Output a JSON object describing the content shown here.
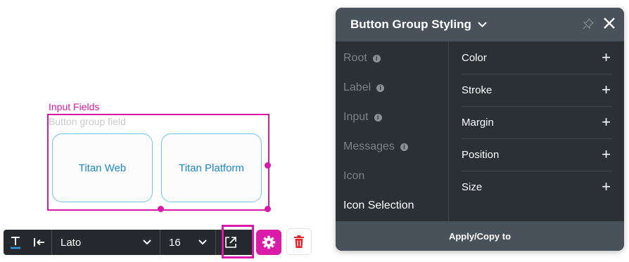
{
  "canvas": {
    "component_title": "Input Fields",
    "component_subtitle": "Button group field",
    "options": [
      {
        "label": "Titan Web"
      },
      {
        "label": "Titan Platform"
      }
    ],
    "accent_color": "#d91ba8"
  },
  "toolbar": {
    "text_icon": "text-format-icon",
    "align_icon": "align-left-icon",
    "font_family": "Lato",
    "font_size": "16",
    "external_link_icon": "external-link-icon",
    "settings_icon": "gear-icon",
    "delete_icon": "trash-icon"
  },
  "panel": {
    "title": "Button Group Styling",
    "left_items": [
      {
        "label": "Root",
        "info": true
      },
      {
        "label": "Label",
        "info": true
      },
      {
        "label": "Input",
        "info": true
      },
      {
        "label": "Messages",
        "info": true
      },
      {
        "label": "Icon",
        "info": false
      },
      {
        "label": "Icon Selection",
        "info": false,
        "active": true
      }
    ],
    "properties": [
      {
        "label": "Color"
      },
      {
        "label": "Stroke"
      },
      {
        "label": "Margin"
      },
      {
        "label": "Position"
      },
      {
        "label": "Size"
      }
    ],
    "footer_label": "Apply/Copy to",
    "info_glyph": "i",
    "plus_glyph": "+"
  }
}
